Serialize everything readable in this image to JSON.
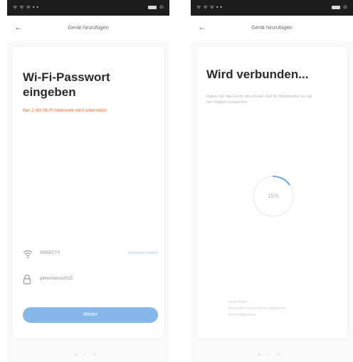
{
  "left": {
    "status_bar": {
      "left_text": "ᯤ ᯤ ᯤ ▪ ▪",
      "right_text": "⊙"
    },
    "nav": {
      "title": "Gerät hinzufügen"
    },
    "heading": "Wi-Fi-Passwort eingeben",
    "warning": "Nur 2,4G Wi-Fi Netzwerk wird unterstützt",
    "wifi": {
      "ssid": "SSRECTY",
      "switch_link": "Netzwerk ändern"
    },
    "password": {
      "value": "pwrecmerce2015"
    },
    "button": {
      "label": "Weiter"
    }
  },
  "right": {
    "status_bar": {
      "left_text": "ᯤ ᯤ ᯤ ▪ ▪",
      "right_text": "⊙"
    },
    "nav": {
      "title": "Gerät hinzufügen"
    },
    "heading": "Wird verbunden...",
    "hint": "Halten Sie das Gerät, den Router und Ihr Mobiltelefon so nah wie möglich zusammen.",
    "progress": {
      "label": "15%",
      "fraction": 0.15
    },
    "steps": [
      "Gerät finden",
      "Gerät beim Cloud-Server registrieren",
      "Gerät initialisieren"
    ]
  },
  "colors": {
    "accent": "#86b7ea",
    "warning": "#ff6a2b",
    "status_bar": "#1d1d1d"
  }
}
